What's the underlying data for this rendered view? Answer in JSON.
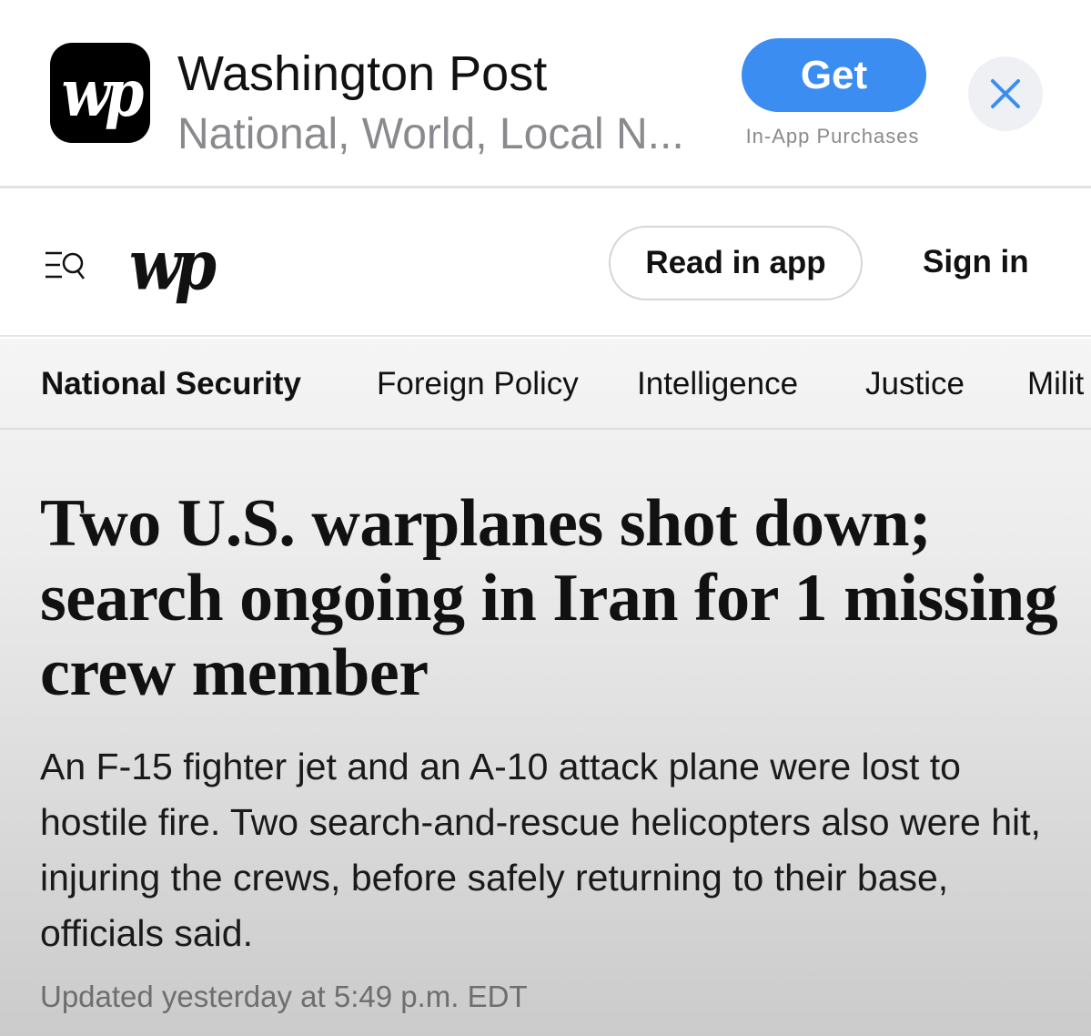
{
  "app_banner": {
    "icon_text": "wp",
    "name": "Washington Post",
    "subtitle": "National, World, Local N...",
    "get_label": "Get",
    "iap_note": "In-App Purchases",
    "close_icon": "close-icon",
    "accent_color": "#3b8df1"
  },
  "header": {
    "menu_icon": "menu-search-icon",
    "logo_text": "wp",
    "read_in_app_label": "Read in app",
    "sign_in_label": "Sign in"
  },
  "section_nav": {
    "items": [
      {
        "label": "National Security",
        "active": true
      },
      {
        "label": "Foreign Policy",
        "active": false
      },
      {
        "label": "Intelligence",
        "active": false
      },
      {
        "label": "Justice",
        "active": false
      },
      {
        "label": "Milit",
        "active": false
      }
    ]
  },
  "article": {
    "headline": "Two U.S. warplanes shot down; search ongoing in Iran for 1 missing crew member",
    "dek": "An F-15 fighter jet and an A-10 attack plane were lost to hostile fire. Two search-and-rescue helicopters also were hit, injuring the crews, before safely returning to their base, officials said.",
    "timestamp": "Updated yesterday at 5:49 p.m. EDT"
  }
}
